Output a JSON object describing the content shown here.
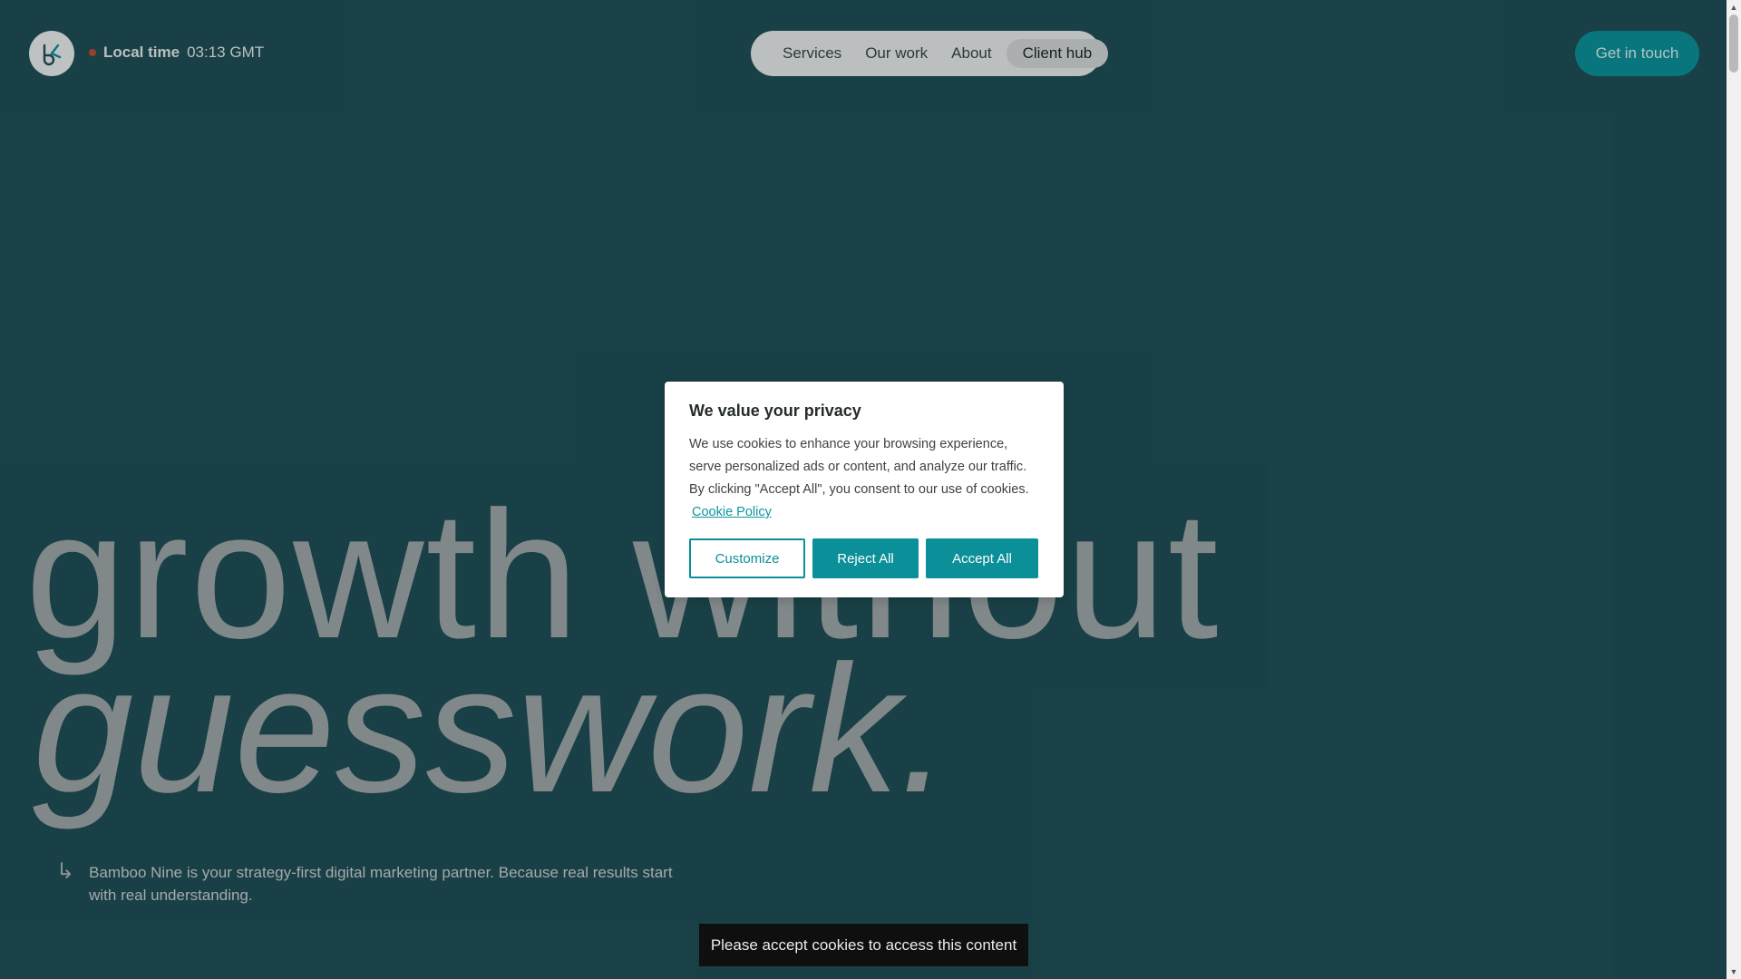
{
  "header": {
    "local_time_label": "Local time",
    "local_time_value": "03:13 GMT",
    "nav": {
      "services": "Services",
      "our_work": "Our work",
      "about": "About",
      "client_hub": "Client hub"
    },
    "cta_label": "Get in touch"
  },
  "hero": {
    "line1": "growth without",
    "line2": "guesswork.",
    "intro": "Bamboo Nine is your strategy-first digital marketing partner. Because real results start with real understanding."
  },
  "cookie_modal": {
    "title": "We value your privacy",
    "body": "We use cookies to enhance your browsing experience, serve personalized ads or content, and analyze our traffic. By clicking \"Accept All\", you consent to our use of cookies.",
    "policy_link": "Cookie Policy",
    "buttons": {
      "customize": "Customize",
      "reject": "Reject All",
      "accept": "Accept All"
    }
  },
  "toast": "Please accept cookies to access this content",
  "colors": {
    "background": "#1f4f56",
    "accent": "#0b8f98",
    "hero_text": "#9ea6a8"
  },
  "icons": {
    "logo": "bamboo-nine-logo",
    "status_dot": "status-dot-icon",
    "intro_arrow": "arrow-down-right-icon"
  }
}
